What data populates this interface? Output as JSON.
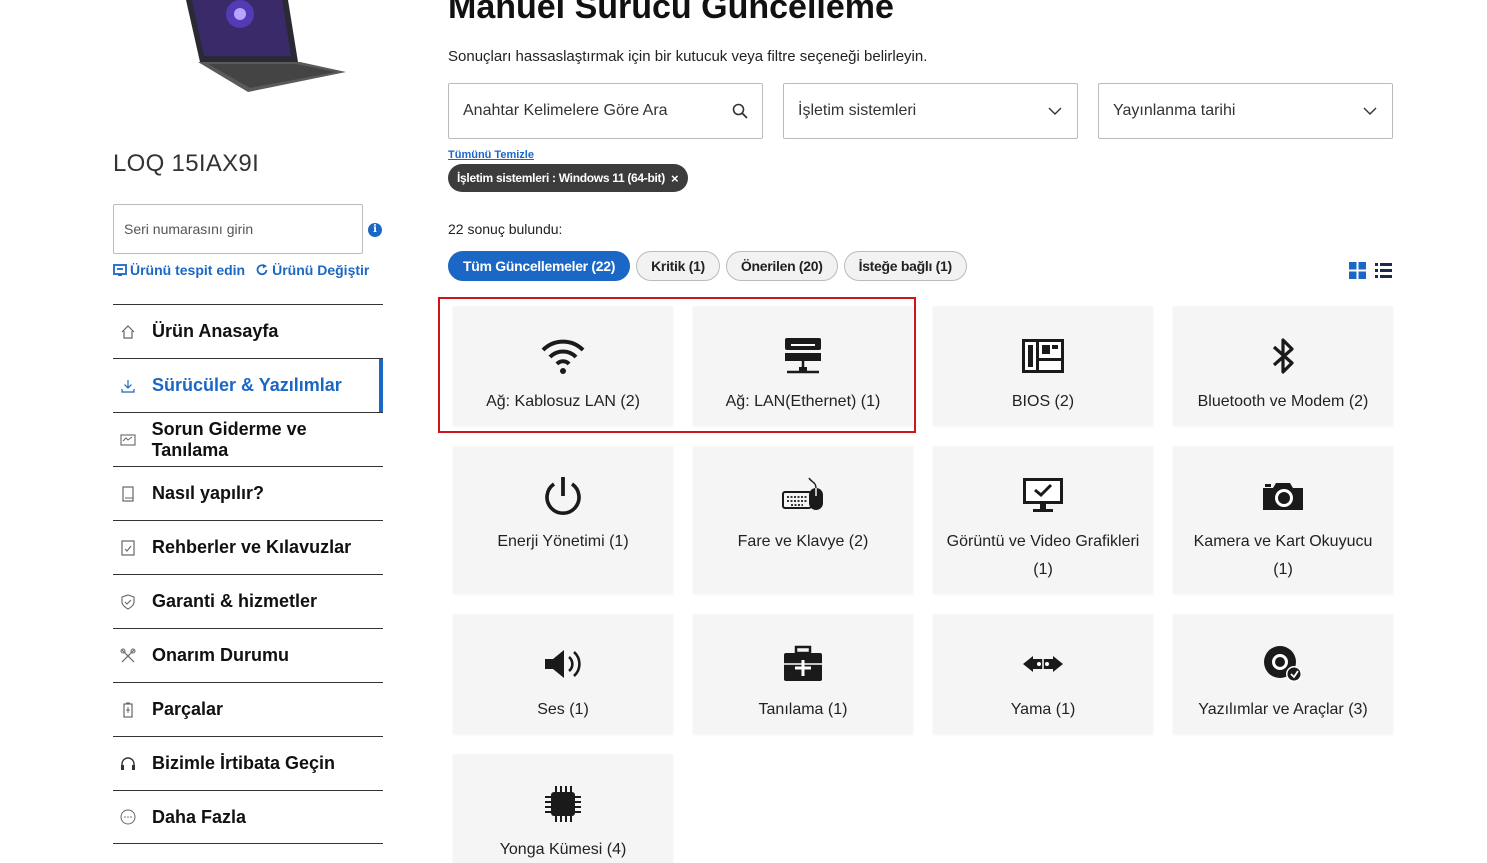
{
  "product": {
    "name": "LOQ 15IAX9I",
    "serial_placeholder": "Seri numarasını girin",
    "info_glyph": "i",
    "detect_label": "Ürünü tespit edin",
    "change_label": "Ürünü Değiştir"
  },
  "sidebar": {
    "items": [
      {
        "label": "Ürün Anasayfa",
        "icon": "home-icon"
      },
      {
        "label": "Sürücüler & Yazılımlar",
        "icon": "download-icon",
        "active": true
      },
      {
        "label": "Sorun Giderme ve Tanılama",
        "icon": "troubleshoot-icon"
      },
      {
        "label": "Nasıl yapılır?",
        "icon": "book-icon"
      },
      {
        "label": "Rehberler ve Kılavuzlar",
        "icon": "guide-icon"
      },
      {
        "label": "Garanti & hizmetler",
        "icon": "shield-icon"
      },
      {
        "label": "Onarım Durumu",
        "icon": "tools-icon"
      },
      {
        "label": "Parçalar",
        "icon": "battery-icon"
      },
      {
        "label": "Bizimle İrtibata Geçin",
        "icon": "headset-icon"
      },
      {
        "label": "Daha Fazla",
        "icon": "more-icon"
      }
    ]
  },
  "main": {
    "title": "Manuel Sürücü Güncelleme",
    "subtitle": "Sonuçları hassaslaştırmak için bir kutucuk veya filtre seçeneği belirleyin.",
    "search_placeholder": "Anahtar Kelimelere Göre Ara",
    "os_filter": "İşletim sistemleri",
    "date_filter": "Yayınlanma tarihi",
    "clear_all": "Tümünü Temizle",
    "chip_label": "İşletim sistemleri : Windows 11 (64-bit)",
    "chip_close": "×",
    "results": "22 sonuç bulundu:",
    "tabs": [
      {
        "label": "Tüm Güncellemeler (22)",
        "active": true
      },
      {
        "label": "Kritik (1)"
      },
      {
        "label": "Önerilen (20)"
      },
      {
        "label": "İsteğe bağlı (1)"
      }
    ],
    "categories": [
      {
        "label": "Ağ: Kablosuz LAN (2)",
        "icon": "wifi-icon"
      },
      {
        "label": "Ağ: LAN(Ethernet) (1)",
        "icon": "ethernet-icon"
      },
      {
        "label": "BIOS (2)",
        "icon": "bios-chip-icon"
      },
      {
        "label": "Bluetooth ve Modem (2)",
        "icon": "bluetooth-icon"
      },
      {
        "label": "Enerji Yönetimi (1)",
        "icon": "power-icon"
      },
      {
        "label": "Fare ve Klavye (2)",
        "icon": "keyboard-mouse-icon"
      },
      {
        "label": "Görüntü ve Video Grafikleri (1)",
        "icon": "monitor-icon"
      },
      {
        "label": "Kamera ve Kart Okuyucu (1)",
        "icon": "camera-icon"
      },
      {
        "label": "Ses (1)",
        "icon": "speaker-icon"
      },
      {
        "label": "Tanılama (1)",
        "icon": "toolbox-icon"
      },
      {
        "label": "Yama (1)",
        "icon": "patch-icon"
      },
      {
        "label": "Yazılımlar ve Araçlar (3)",
        "icon": "software-disc-icon"
      },
      {
        "label": "Yonga Kümesi (4)",
        "icon": "chipset-icon"
      }
    ]
  },
  "colors": {
    "accent": "#1a67c6",
    "highlight": "#d0141c"
  }
}
